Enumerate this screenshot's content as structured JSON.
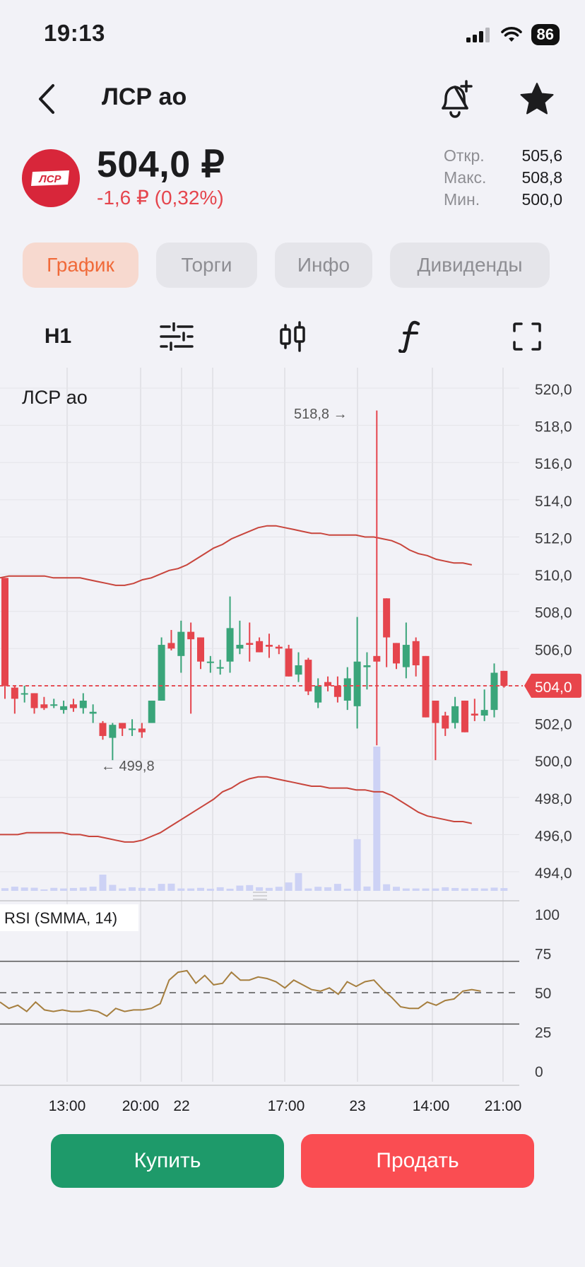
{
  "status": {
    "time": "19:13",
    "battery": "86"
  },
  "header": {
    "title": "ЛСР ао",
    "logo_text": "ЛСР"
  },
  "quote": {
    "price": "504,0 ₽",
    "change": "-1,6 ₽ (0,32%)",
    "stats": [
      {
        "label": "Откр.",
        "value": "505,6"
      },
      {
        "label": "Макс.",
        "value": "508,8"
      },
      {
        "label": "Мин.",
        "value": "500,0"
      }
    ]
  },
  "tabs": [
    "График",
    "Торги",
    "Инфо",
    "Дивиденды"
  ],
  "toolbar": {
    "timeframe": "H1"
  },
  "colors": {
    "up": "#3aa57a",
    "down": "#e5454d",
    "bands": "#c8453c",
    "rsi": "#a67f3f",
    "volume": "#cdd2f5"
  },
  "chart_data": {
    "type": "candlestick",
    "title": "ЛСР ао",
    "y_ticks": [
      "520,0",
      "518,0",
      "516,0",
      "514,0",
      "512,0",
      "510,0",
      "508,0",
      "506,0",
      "504,0",
      "502,0",
      "500,0",
      "498,0",
      "496,0",
      "494,0"
    ],
    "ylim": [
      493.2,
      521.2
    ],
    "x_ticks": [
      "13:00",
      "20:00",
      "22",
      "17:00",
      "23",
      "14:00",
      "21:00"
    ],
    "last_price": "504,0",
    "last_price_value": 504.0,
    "annotations": {
      "max": "518,8",
      "min": "499,8"
    },
    "candles": [
      [
        509.8,
        509.8,
        503.3,
        504.0
      ],
      [
        503.9,
        504.0,
        502.5,
        503.3
      ],
      [
        503.6,
        504.0,
        503.1,
        503.6
      ],
      [
        503.6,
        503.6,
        502.5,
        502.8
      ],
      [
        503.0,
        503.4,
        502.7,
        502.8
      ],
      [
        503.0,
        503.3,
        502.8,
        503.0
      ],
      [
        502.7,
        503.2,
        502.5,
        502.9
      ],
      [
        503.0,
        503.3,
        502.6,
        502.8
      ],
      [
        502.8,
        503.6,
        502.5,
        503.2
      ],
      [
        502.5,
        503.0,
        502.0,
        502.6
      ],
      [
        502.0,
        502.1,
        501.1,
        501.3
      ],
      [
        501.2,
        502.0,
        500.0,
        501.9
      ],
      [
        502.0,
        502.0,
        501.3,
        501.7
      ],
      [
        501.7,
        502.2,
        501.3,
        501.7
      ],
      [
        501.7,
        502.0,
        501.2,
        501.5
      ],
      [
        502.0,
        503.2,
        502.0,
        503.2
      ],
      [
        503.2,
        506.6,
        503.2,
        506.2
      ],
      [
        506.3,
        507.0,
        505.9,
        506.0
      ],
      [
        505.6,
        507.5,
        504.7,
        506.9
      ],
      [
        506.9,
        507.4,
        502.5,
        506.5
      ],
      [
        506.6,
        506.6,
        504.9,
        505.3
      ],
      [
        505.3,
        505.6,
        504.7,
        505.3
      ],
      [
        505.0,
        505.4,
        504.6,
        505.0
      ],
      [
        505.3,
        508.8,
        504.7,
        507.1
      ],
      [
        506.0,
        507.5,
        505.7,
        506.2
      ],
      [
        506.3,
        507.4,
        505.3,
        506.2
      ],
      [
        506.4,
        506.6,
        505.8,
        505.8
      ],
      [
        506.2,
        506.8,
        505.5,
        506.1
      ],
      [
        506.1,
        506.2,
        505.7,
        506.0
      ],
      [
        506.0,
        506.2,
        504.5,
        504.5
      ],
      [
        504.6,
        505.8,
        504.2,
        505.1
      ],
      [
        505.4,
        505.5,
        503.5,
        503.7
      ],
      [
        503.1,
        504.4,
        502.8,
        504.0
      ],
      [
        504.2,
        504.5,
        503.7,
        504.0
      ],
      [
        504.0,
        504.5,
        503.1,
        503.4
      ],
      [
        503.2,
        505.0,
        502.7,
        504.4
      ],
      [
        502.9,
        507.7,
        501.7,
        505.3
      ],
      [
        505.0,
        505.8,
        503.8,
        505.1
      ],
      [
        505.6,
        518.8,
        500.8,
        505.3
      ],
      [
        508.7,
        508.7,
        505.0,
        506.6
      ],
      [
        506.3,
        506.3,
        504.9,
        505.2
      ],
      [
        505.0,
        507.4,
        504.4,
        506.2
      ],
      [
        506.4,
        506.6,
        504.5,
        505.1
      ],
      [
        505.6,
        505.6,
        502.3,
        502.3
      ],
      [
        503.2,
        503.2,
        500.0,
        502.0
      ],
      [
        502.4,
        502.6,
        501.3,
        501.7
      ],
      [
        502.0,
        503.4,
        501.7,
        502.9
      ],
      [
        503.2,
        503.2,
        501.5,
        501.5
      ],
      [
        502.5,
        503.3,
        502.1,
        502.4
      ],
      [
        502.4,
        503.8,
        502.1,
        502.7
      ],
      [
        502.7,
        505.2,
        502.3,
        504.7
      ],
      [
        504.8,
        504.8,
        503.9,
        504.0
      ]
    ],
    "volume": [
      0.22,
      0.35,
      0.28,
      0.26,
      0.12,
      0.25,
      0.2,
      0.24,
      0.28,
      0.35,
      1.35,
      0.5,
      0.2,
      0.3,
      0.25,
      0.22,
      0.58,
      0.6,
      0.2,
      0.2,
      0.25,
      0.18,
      0.3,
      0.18,
      0.44,
      0.48,
      0.3,
      0.25,
      0.34,
      0.7,
      1.48,
      0.2,
      0.34,
      0.3,
      0.58,
      0.18,
      4.3,
      0.36,
      12.0,
      0.55,
      0.34,
      0.2,
      0.2,
      0.2,
      0.2,
      0.3,
      0.24,
      0.2,
      0.22,
      0.2,
      0.27,
      0.23
    ],
    "bands": {
      "upper": [
        509.8,
        509.9,
        509.9,
        509.9,
        509.9,
        509.9,
        509.8,
        509.8,
        509.8,
        509.8,
        509.7,
        509.6,
        509.5,
        509.4,
        509.4,
        509.5,
        509.7,
        509.8,
        510.0,
        510.2,
        510.3,
        510.5,
        510.8,
        511.1,
        511.4,
        511.6,
        511.9,
        512.1,
        512.3,
        512.5,
        512.6,
        512.6,
        512.5,
        512.4,
        512.3,
        512.2,
        512.2,
        512.1,
        512.1,
        512.1,
        512.1,
        512.0,
        512.0,
        511.9,
        511.8,
        511.6,
        511.3,
        511.1,
        511.0,
        510.8,
        510.7,
        510.6,
        510.6,
        510.5
      ],
      "lower": [
        496.0,
        496.0,
        496.0,
        496.1,
        496.1,
        496.1,
        496.1,
        496.1,
        496.0,
        496.0,
        495.9,
        495.9,
        495.8,
        495.7,
        495.6,
        495.6,
        495.7,
        495.9,
        496.1,
        496.4,
        496.7,
        497.0,
        497.3,
        497.6,
        497.9,
        498.3,
        498.5,
        498.8,
        499.0,
        499.1,
        499.1,
        499.0,
        498.9,
        498.8,
        498.7,
        498.6,
        498.6,
        498.5,
        498.5,
        498.5,
        498.4,
        498.4,
        498.3,
        498.3,
        498.1,
        497.8,
        497.5,
        497.2,
        497.0,
        496.9,
        496.8,
        496.7,
        496.7,
        496.6
      ]
    },
    "rsi": {
      "label": "RSI (SMMA, 14)",
      "ticks": [
        "100",
        "75",
        "50",
        "25",
        "0"
      ],
      "levels": [
        30,
        70
      ],
      "values": [
        44,
        40,
        42,
        38,
        44,
        39,
        38,
        39,
        38,
        38,
        39,
        38,
        35,
        40,
        38,
        39,
        39,
        40,
        43,
        58,
        63,
        64,
        56,
        61,
        55,
        56,
        63,
        58,
        58,
        60,
        59,
        57,
        53,
        58,
        55,
        52,
        51,
        53,
        49,
        57,
        54,
        57,
        58,
        52,
        47,
        41,
        40,
        40,
        44,
        42,
        45,
        46,
        51,
        52,
        51
      ]
    }
  }
}
